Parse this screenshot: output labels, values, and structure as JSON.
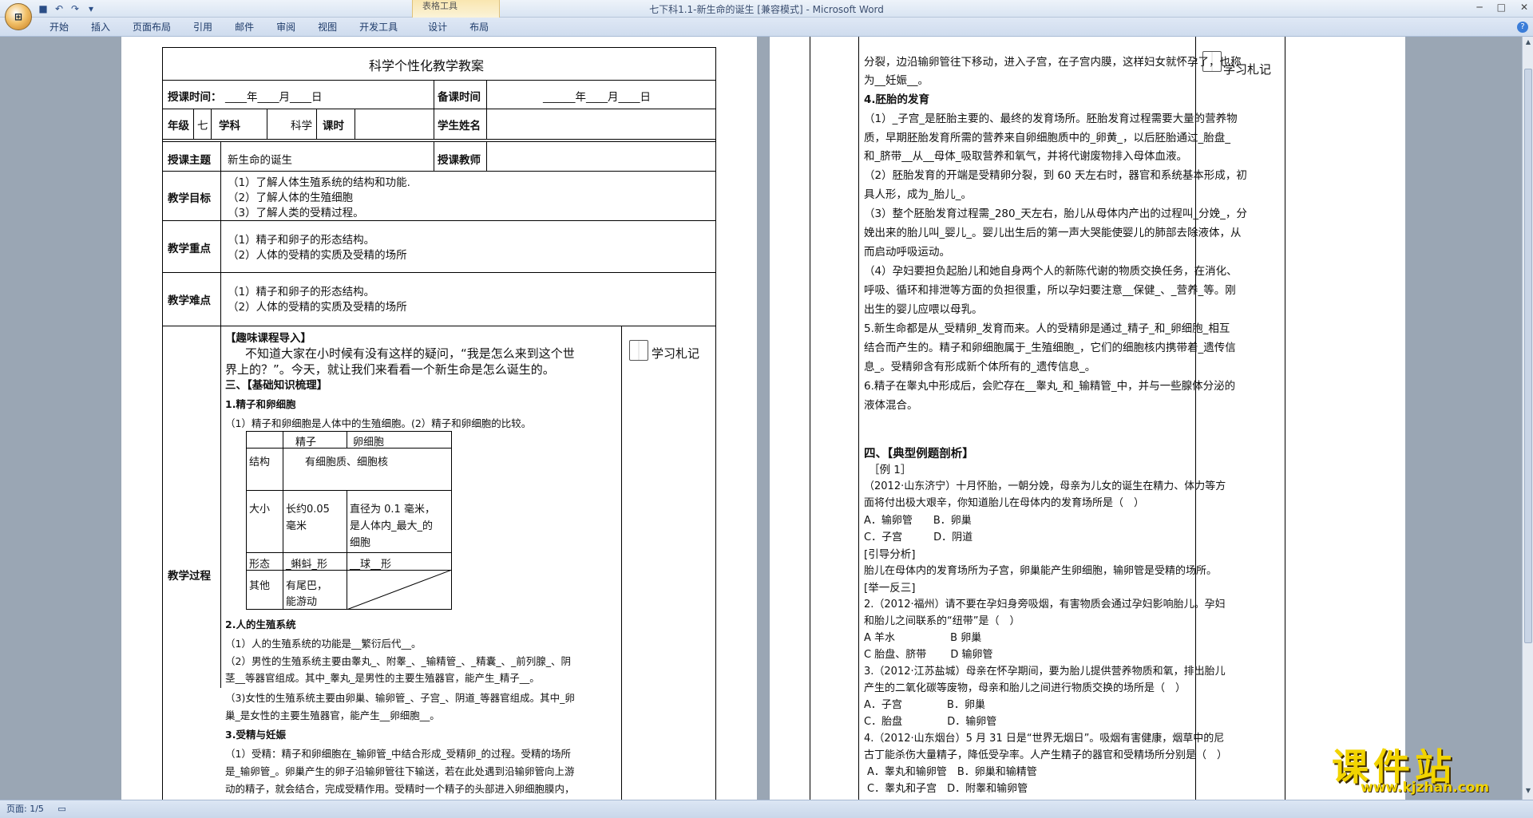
{
  "app": {
    "title": "七下科1.1-新生命的诞生 [兼容模式] - Microsoft Word",
    "contextual_group": "表格工具"
  },
  "ribbon": {
    "tabs": [
      "开始",
      "插入",
      "页面布局",
      "引用",
      "邮件",
      "审阅",
      "视图",
      "开发工具",
      "设计",
      "布局"
    ]
  },
  "status": {
    "page": "页面: 1/5"
  },
  "colors": {
    "logo": "#f2d400",
    "workspace": "#9aa6b4"
  },
  "page1": {
    "title": "科学个性化教学教案",
    "row1": {
      "l1": "授课时间：",
      "v1": "____年____月____日",
      "l2": "备课时间",
      "v2": "______年____月____日"
    },
    "row2": {
      "grade_l": "年级",
      "grade_v": "七",
      "subj_l": "学科",
      "subj_v": "科学",
      "hours_l": "课时",
      "name_l": "学生姓名"
    },
    "row3": {
      "theme_l": "授课主题",
      "theme_v": "新生命的诞生",
      "teacher_l": "授课教师"
    },
    "goals": {
      "label": "教学目标",
      "items": [
        "（1）了解人体生殖系统的结构和功能.",
        "（2）了解人体的生殖细胞",
        "（3）了解人类的受精过程。"
      ]
    },
    "keys": {
      "label": "教学重点",
      "items": [
        "（1）精子和卵子的形态结构。",
        "（2）人体的受精的实质及受精的场所"
      ]
    },
    "diff": {
      "label": "教学难点",
      "items": [
        "（1）精子和卵子的形态结构。",
        "（2）人体的受精的实质及受精的场所"
      ]
    },
    "process": {
      "label": "教学过程",
      "notes": "学习札记",
      "lines": [
        "【趣味课程导入】",
        "不知道大家在小时候有没有这样的疑问，“我是怎么来到这个世",
        "界上的？”。今天，就让我们来看看一个新生命是怎么诞生的。",
        "三、【基础知识梳理】",
        "1.精子和卵细胞",
        "（1）精子和卵细胞是人体中的生殖细胞。(2）精子和卵细胞的比较。"
      ],
      "table": {
        "h1": "精子",
        "h2": "卵细胞",
        "r1": "结构",
        "r1v": "有细胞质、细胞核",
        "r2": "大小",
        "r2a": "长约0.05",
        "r2b": "毫米",
        "r2c": "直径为 0.1 毫米，",
        "r2d": "是人体内_最大_的",
        "r2e": "细胞",
        "r3": "形态",
        "r3a": "_蝌蚪_形",
        "r3b": "__球__形",
        "r4": "其他",
        "r4a": "有尾巴，",
        "r4b": "能游动"
      },
      "lines2": [
        "2.人的生殖系统",
        "（1）人的生殖系统的功能是__繁衍后代__。",
        "（2）男性的生殖系统主要由睾丸_、附睾_、_输精管_、_精囊_、_前列腺_、阴",
        "茎__等器官组成。其中_睾丸_是男性的主要生殖器官，能产生_精子__。",
        "（3)女性的生殖系统主要由卵巢、输卵管_、子宫_、阴道_等器官组成。其中_卵",
        "巢_是女性的主要生殖器官，能产生__卵细胞__。",
        "3.受精与妊娠",
        "（1）受精：精子和卵细胞在_输卵管_中结合形成_受精卵_的过程。受精的场所",
        "是_输卵管_。卵巢产生的卵子沿输卵管往下输送，若在此处遇到沿输卵管向上游",
        "动的精子，就会结合，完成受精作用。受精时一个精子的头部进入卵细胞膜内，"
      ]
    }
  },
  "page2": {
    "notes": "学习札记",
    "lines": [
      "分裂，边沿输卵管往下移动，进入子宫，在子宫内膜，这样妇女就怀孕了，也称",
      "为__妊娠__。",
      "4.胚胎的发育",
      "（1）_子宫_是胚胎主要的、最终的发育场所。胚胎发育过程需要大量的营养物",
      "质，早期胚胎发育所需的营养来自卵细胞质中的_卵黄_，以后胚胎通过_胎盘_",
      "和_脐带__从__母体_吸取营养和氧气，并将代谢废物排入母体血液。",
      "（2）胚胎发育的开端是受精卵分裂，到 60 天左右时，器官和系统基本形成，初",
      "具人形，成为_胎儿_。",
      "（3）整个胚胎发育过程需_280_天左右，胎儿从母体内产出的过程叫_分娩_，分",
      "娩出来的胎儿叫_婴儿_。婴儿出生后的第一声大哭能使婴儿的肺部去除液体，从",
      "而启动呼吸运动。",
      "（4）孕妇要担负起胎儿和她自身两个人的新陈代谢的物质交换任务，在消化、",
      "呼吸、循环和排泄等方面的负担很重，所以孕妇要注意__保健_、_营养_等。刚",
      "出生的婴儿应喂以母乳。",
      "5.新生命都是从_受精卵_发育而来。人的受精卵是通过_精子_和_卵细胞_相互",
      "结合而产生的。精子和卵细胞属于_生殖细胞_，它们的细胞核内携带着_遗传信",
      "息_。受精卵含有形成新个体所有的_遗传信息_。",
      "6.精子在睾丸中形成后，会贮存在__睾丸_和_输精管_中，并与一些腺体分泌的",
      "液体混合。"
    ],
    "lines2": [
      "四、【典型例题剖析】",
      "［例 1］",
      "（2012·山东济宁）十月怀胎，一朝分娩，母亲为儿女的诞生在精力、体力等方",
      "面将付出极大艰辛，你知道胎儿在母体内的发育场所是（　）",
      "A．输卵管　　B．卵巢",
      "C．子宫　　　D．阴道",
      "[引导分析]",
      "胎儿在母体内的发育场所为子宫，卵巢能产生卵细胞，输卵管是受精的场所。",
      "[举一反三]",
      "2.（2012·福州）请不要在孕妇身旁吸烟，有害物质会通过孕妇影响胎儿。孕妇",
      "和胎儿之间联系的“纽带”是（　）",
      "A 羊水　　　　　 B 卵巢",
      "C 胎盘、脐带　　 D 输卵管",
      "3.（2012·江苏盐城）母亲在怀孕期间，要为胎儿提供营养物质和氧，排出胎儿",
      "产生的二氧化碳等废物，母亲和胎儿之间进行物质交换的场所是（　）",
      "A．子宫　　　　 B．卵巢",
      "C．胎盘　　　　 D．输卵管",
      "4.（2012·山东烟台）5 月 31 日是“世界无烟日”。吸烟有害健康，烟草中的尼",
      "古丁能杀伤大量精子，降低受孕率。人产生精子的器官和受精场所分别是（　）",
      "A．睾丸和输卵管　B．卵巢和输精管",
      "C．睾丸和子宫　D．附睾和输卵管"
    ]
  },
  "logo": {
    "big": "课件站",
    "small": "www.kjzhan.com"
  }
}
